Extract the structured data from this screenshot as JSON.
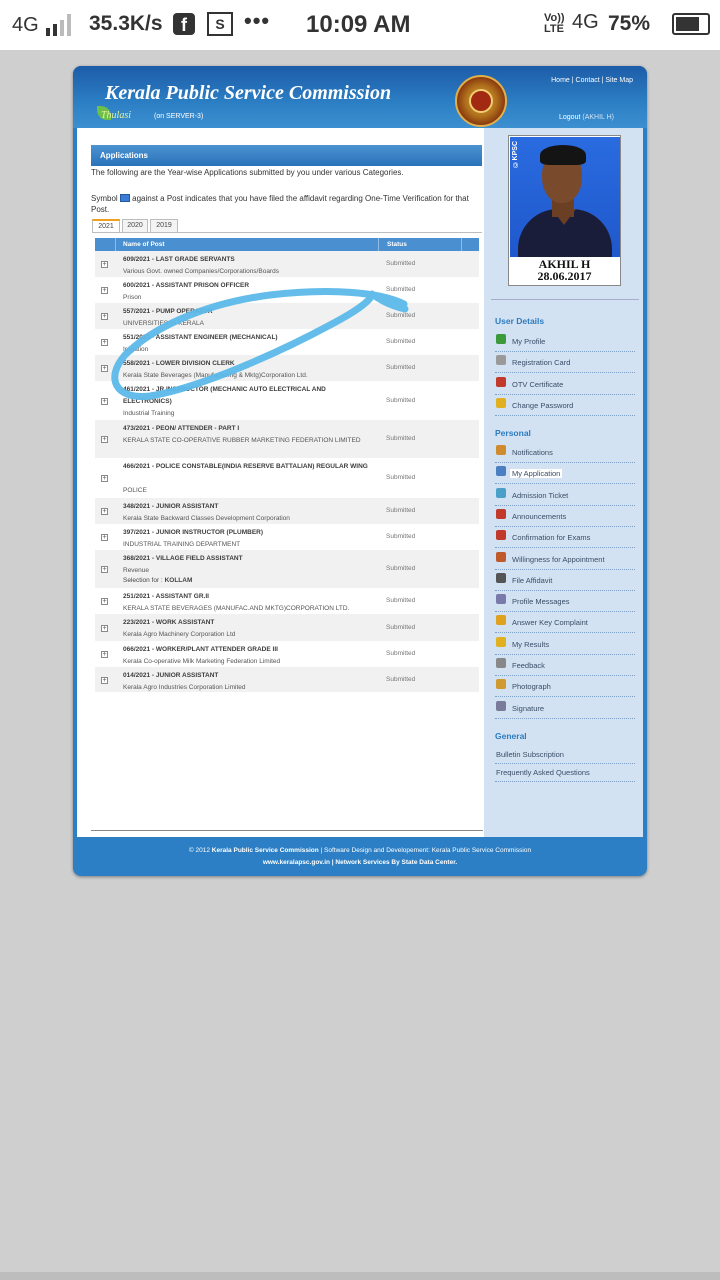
{
  "status_bar": {
    "network": "4G",
    "speed": "35.3K/s",
    "fb_icon": "facebook-icon",
    "screenshot_icon": "S",
    "dots": "•••",
    "time": "10:09 AM",
    "volte_top": "Vo))",
    "volte_bottom": "LTE",
    "network2": "4G",
    "battery": "75%",
    "battery_level": 0.75
  },
  "header": {
    "title": "Kerala Public Service Commission",
    "thulasi": "Thulasi",
    "server": "(on SERVER-3)",
    "links": [
      "Home",
      "Contact",
      "Site Map"
    ],
    "logout": "Logout",
    "user": "(AKHIL H)"
  },
  "main": {
    "section_title": "Applications",
    "intro": "The following are the Year-wise Applications submitted by you under various Categories.",
    "symbol_prefix": "Symbol",
    "symbol_suffix": "against a Post indicates that you have filed the affidavit regarding One-Time Verification for that Post.",
    "tabs": [
      "2021",
      "2020",
      "2019"
    ],
    "active_tab": "2021",
    "columns": {
      "name": "Name of Post",
      "status": "Status"
    },
    "rows": [
      {
        "post": "609/2021 - LAST GRADE SERVANTS",
        "org": "Various Govt. owned Companies/Corporations/Boards",
        "status": "Submitted"
      },
      {
        "post": "600/2021 - ASSISTANT PRISON OFFICER",
        "org": "Prison",
        "status": "Submitted"
      },
      {
        "post": "557/2021 - PUMP OPERATOR",
        "org": "UNIVERSITIES IN KERALA",
        "status": "Submitted"
      },
      {
        "post": "551/2021 - ASSISTANT ENGINEER (MECHANICAL)",
        "org": "Irrigation",
        "status": "Submitted"
      },
      {
        "post": "558/2021 - LOWER DIVISION CLERK",
        "org": "Kerala State Beverages (Manufacturing & Mktg)Corporation Ltd.",
        "status": "Submitted"
      },
      {
        "post": "461/2021 - JR INSTRUCTOR (MECHANIC AUTO ELECTRICAL AND ELECTRONICS)",
        "org": "Industrial Training",
        "status": "Submitted"
      },
      {
        "post": "473/2021 - PEON/ ATTENDER - PART I",
        "org": "KERALA STATE CO-OPERATIVE RUBBER MARKETING FEDERATION LIMITED",
        "status": "Submitted"
      },
      {
        "post": "466/2021 - POLICE CONSTABLE(INDIA RESERVE BATTALIAN) REGULAR WING",
        "org": "POLICE",
        "status": "Submitted"
      },
      {
        "post": "348/2021 - JUNIOR ASSISTANT",
        "org": "Kerala State Backward Classes Development Corporation",
        "status": "Submitted"
      },
      {
        "post": "397/2021 - JUNIOR INSTRUCTOR (PLUMBER)",
        "org": "INDUSTRIAL TRAINING DEPARTMENT",
        "status": "Submitted"
      },
      {
        "post": "368/2021 - VILLAGE FIELD ASSISTANT",
        "org": "Revenue",
        "status": "Submitted",
        "extra_label": "Selection for :",
        "extra_value": "KOLLAM"
      },
      {
        "post": "251/2021 - ASSISTANT GR.II",
        "org": "KERALA STATE BEVERAGES (MANUFAC.AND MKTG)CORPORATION LTD.",
        "status": "Submitted"
      },
      {
        "post": "223/2021 - WORK ASSISTANT",
        "org": "Kerala Agro Machinery Corporation Ltd",
        "status": "Submitted"
      },
      {
        "post": "066/2021 - WORKER/PLANT ATTENDER GRADE III",
        "org": "Kerala Co-operative Milk Marketing Federation Limited",
        "status": "Submitted"
      },
      {
        "post": "014/2021 - JUNIOR ASSISTANT",
        "org": "Kerala Agro Industries Corporation Limited",
        "status": "Submitted"
      }
    ]
  },
  "profile": {
    "tag": "©KPSC",
    "name": "AKHIL H",
    "date": "28.06.2017"
  },
  "sidebar": {
    "user_details": {
      "heading": "User Details",
      "items": [
        {
          "label": "My Profile",
          "icon": "profile-icon",
          "color": "#3c9a3c"
        },
        {
          "label": "Registration Card",
          "icon": "card-icon",
          "color": "#9a9a9a"
        },
        {
          "label": "OTV Certificate",
          "icon": "certificate-icon",
          "color": "#c0392b"
        },
        {
          "label": "Change Password",
          "icon": "password-icon",
          "color": "#e0b020"
        }
      ]
    },
    "personal": {
      "heading": "Personal",
      "items": [
        {
          "label": "Notifications",
          "icon": "notification-icon",
          "color": "#d08a30"
        },
        {
          "label": "My Application",
          "icon": "application-icon",
          "color": "#4a7fc1"
        },
        {
          "label": "Admission Ticket",
          "icon": "ticket-icon",
          "color": "#4aa0c8"
        },
        {
          "label": "Announcements",
          "icon": "announcement-icon",
          "color": "#c0392b"
        },
        {
          "label": "Confirmation for Exams",
          "icon": "calendar-icon",
          "color": "#c0392b"
        },
        {
          "label": "Willingness for Appointment",
          "icon": "willingness-icon",
          "color": "#c05a2a"
        },
        {
          "label": "File Affidavit",
          "icon": "affidavit-icon",
          "color": "#555555"
        },
        {
          "label": "Profile Messages",
          "icon": "messages-icon",
          "color": "#7a7aaa"
        },
        {
          "label": "Answer Key Complaint",
          "icon": "key-icon",
          "color": "#e0a020"
        },
        {
          "label": "My Results",
          "icon": "results-icon",
          "color": "#e0b020"
        },
        {
          "label": "Feedback",
          "icon": "feedback-icon",
          "color": "#888888"
        },
        {
          "label": "Photograph",
          "icon": "photo-icon",
          "color": "#d09a30"
        },
        {
          "label": "Signature",
          "icon": "signature-icon",
          "color": "#7a7a9a"
        }
      ]
    },
    "general": {
      "heading": "General",
      "items": [
        {
          "label": "Bulletin Subscription"
        },
        {
          "label": "Frequently Asked Questions"
        }
      ]
    }
  },
  "footer": {
    "copyright": "© 2012",
    "org": "Kerala Public Service Commission",
    "design": "| Software Design and Developement: Kerala Public Service Commission",
    "line2": "www.keralapsc.gov.in | Network Services By State Data Center."
  },
  "colors": {
    "accent": "#2c7fc4",
    "scribble": "#5bb8e8",
    "sidebar_heading": "#2d7bbf"
  }
}
